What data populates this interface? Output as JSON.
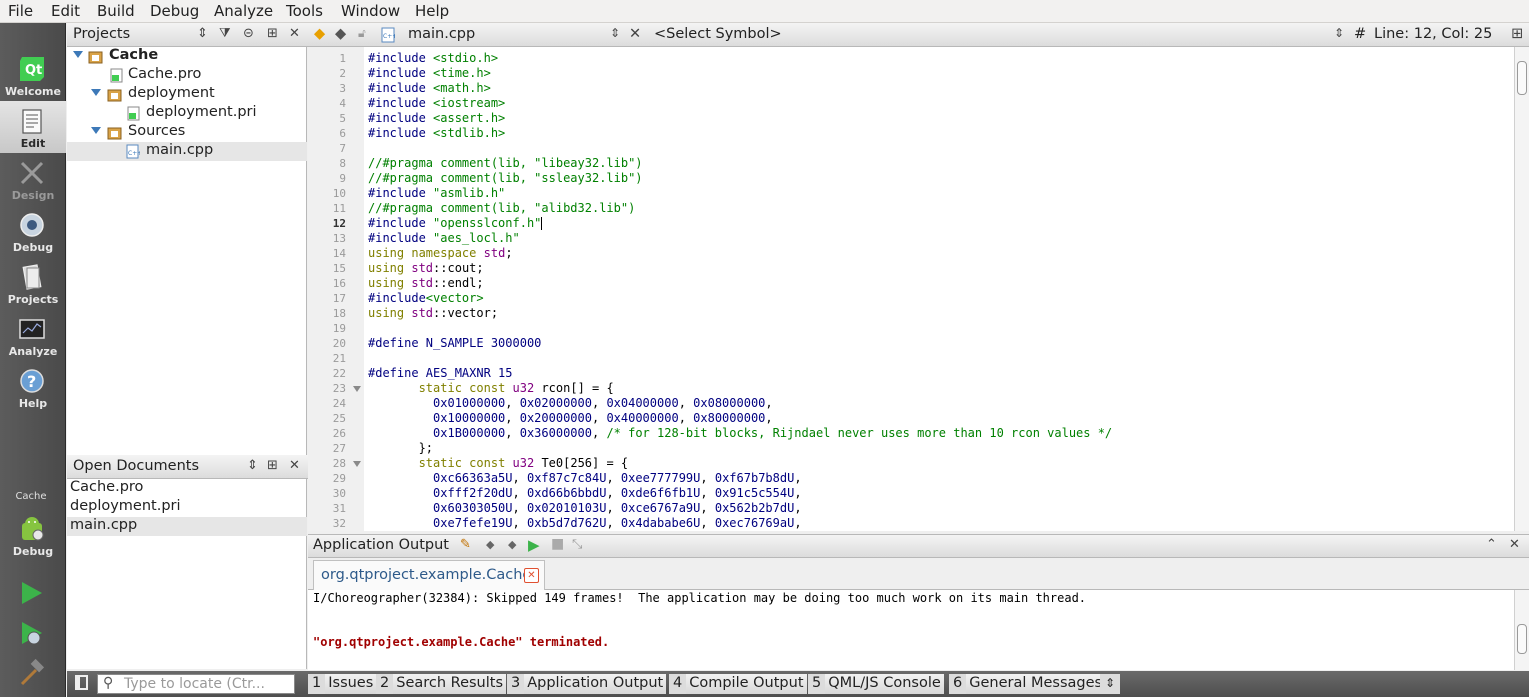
{
  "menu": [
    "File",
    "Edit",
    "Build",
    "Debug",
    "Analyze",
    "Tools",
    "Window",
    "Help"
  ],
  "modes": [
    {
      "label": "Welcome",
      "icon": "qt-logo-icon"
    },
    {
      "label": "Edit",
      "icon": "edit-document-icon"
    },
    {
      "label": "Design",
      "icon": "design-pencil-icon"
    },
    {
      "label": "Debug",
      "icon": "debug-bug-icon"
    },
    {
      "label": "Projects",
      "icon": "projects-icon"
    },
    {
      "label": "Analyze",
      "icon": "analyze-monitor-icon"
    },
    {
      "label": "Help",
      "icon": "help-icon"
    }
  ],
  "kit": {
    "project": "Cache",
    "mode": "Debug"
  },
  "projects_panel": {
    "title": "Projects",
    "tree": [
      {
        "label": "Cache"
      },
      {
        "label": "Cache.pro"
      },
      {
        "label": "deployment"
      },
      {
        "label": "deployment.pri"
      },
      {
        "label": "Sources"
      },
      {
        "label": "main.cpp"
      }
    ]
  },
  "open_documents": {
    "title": "Open Documents",
    "items": [
      "Cache.pro",
      "deployment.pri",
      "main.cpp"
    ]
  },
  "editor": {
    "file_name": "main.cpp",
    "symbol_selector": "<Select Symbol>",
    "hash": "#",
    "position": "Line: 12, Col: 25",
    "current_line": 12,
    "line_numbers": [
      "1",
      "2",
      "3",
      "4",
      "5",
      "6",
      "7",
      "8",
      "9",
      "10",
      "11",
      "12",
      "13",
      "14",
      "15",
      "16",
      "17",
      "18",
      "19",
      "20",
      "21",
      "22",
      "23",
      "24",
      "25",
      "26",
      "27",
      "28",
      "29",
      "30",
      "31",
      "32"
    ],
    "lines": [
      {
        "text": "#include <stdio.h>"
      },
      {
        "text": "#include <time.h>"
      },
      {
        "text": "#include <math.h>"
      },
      {
        "text": "#include <iostream>"
      },
      {
        "text": "#include <assert.h>"
      },
      {
        "text": "#include <stdlib.h>"
      },
      {
        "text": ""
      },
      {
        "text": "//#pragma comment(lib, \"libeay32.lib\")"
      },
      {
        "text": "//#pragma comment(lib, \"ssleay32.lib\")"
      },
      {
        "text": "#include \"asmlib.h\""
      },
      {
        "text": "//#pragma comment(lib, \"alibd32.lib\")"
      },
      {
        "text": "#include \"opensslconf.h\""
      },
      {
        "text": "#include \"aes_locl.h\""
      },
      {
        "text": "using namespace std;"
      },
      {
        "text": "using std::cout;"
      },
      {
        "text": "using std::endl;"
      },
      {
        "text": "#include<vector>"
      },
      {
        "text": "using std::vector;"
      },
      {
        "text": ""
      },
      {
        "text": "#define N_SAMPLE 3000000"
      },
      {
        "text": ""
      },
      {
        "text": "#define AES_MAXNR 15"
      },
      {
        "text": "       static const u32 rcon[] = {"
      },
      {
        "text": "         0x01000000, 0x02000000, 0x04000000, 0x08000000,"
      },
      {
        "text": "         0x10000000, 0x20000000, 0x40000000, 0x80000000,"
      },
      {
        "text": "         0x1B000000, 0x36000000, /* for 128-bit blocks, Rijndael never uses more than 10 rcon values */"
      },
      {
        "text": "       };"
      },
      {
        "text": "       static const u32 Te0[256] = {"
      },
      {
        "text": "         0xc66363a5U, 0xf87c7c84U, 0xee777799U, 0xf67b7b8dU,"
      },
      {
        "text": "         0xfff2f20dU, 0xd66b6bbdU, 0xde6f6fb1U, 0x91c5c554U,"
      },
      {
        "text": "         0x60303050U, 0x02010103U, 0xce6767a9U, 0x562b2b7dU,"
      },
      {
        "text": "         0xe7fefe19U, 0xb5d7d762U, 0x4dababe6U, 0xec76769aU,"
      }
    ]
  },
  "output_pane": {
    "title": "Application Output",
    "tab_label": "org.qtproject.example.Cache",
    "lines": [
      "I/Choreographer(32384): Skipped 149 frames!  The application may be doing too much work on its main thread.",
      "\"org.qtproject.example.Cache\" terminated."
    ]
  },
  "status_bar": {
    "locator_placeholder": "Type to locate (Ctr...",
    "tabs": [
      {
        "num": "1",
        "label": "Issues"
      },
      {
        "num": "2",
        "label": "Search Results"
      },
      {
        "num": "3",
        "label": "Application Output"
      },
      {
        "num": "4",
        "label": "Compile Output"
      },
      {
        "num": "5",
        "label": "QML/JS Console"
      },
      {
        "num": "6",
        "label": "General Messages"
      }
    ]
  },
  "colors": {
    "preprocessor": "#000080",
    "string": "#008000",
    "keyword": "#808000",
    "type": "#800080",
    "comment": "#008000",
    "error_text": "#a00000",
    "accent": "#3d79b8"
  }
}
